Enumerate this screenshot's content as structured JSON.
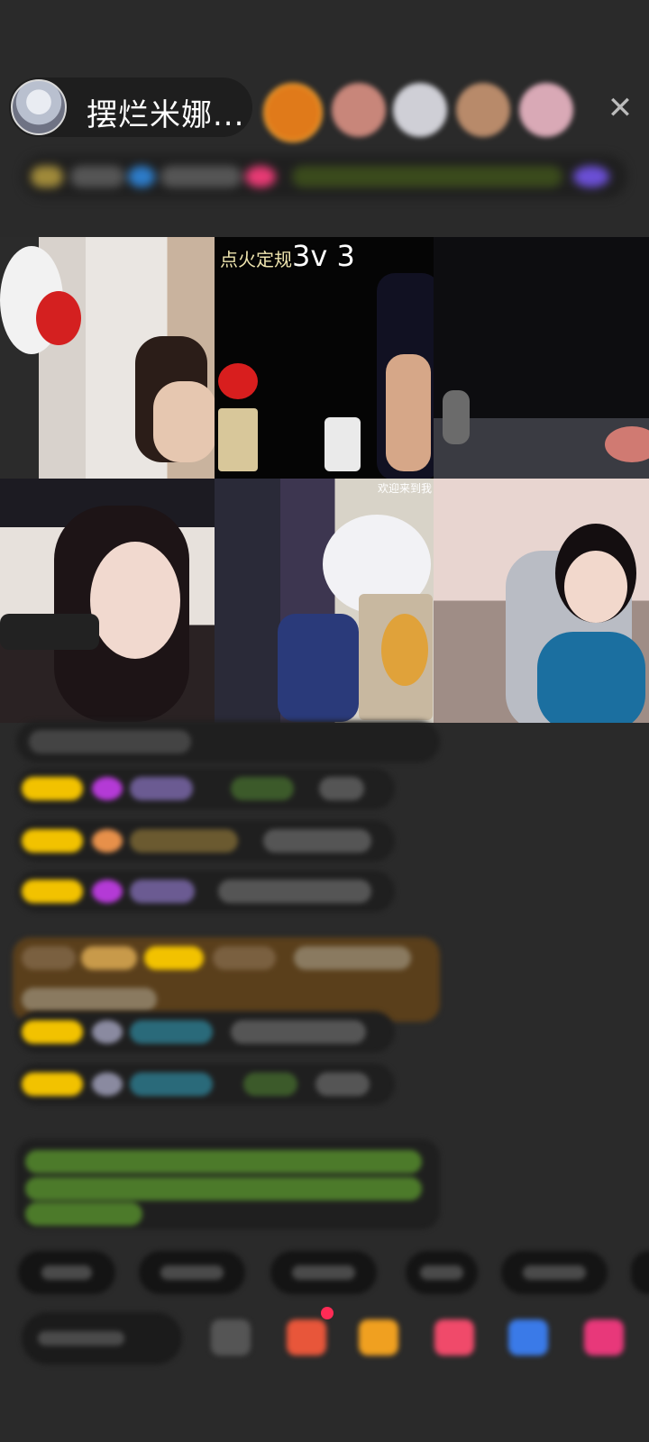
{
  "header": {
    "host_name": "摆烂米娜..."
  },
  "grid": {
    "tile2_label_text": "点火定规",
    "tile2_label_big": "3v 3",
    "tile5_label": "欢迎来到我"
  },
  "colors": {
    "background": "#2a2a2a",
    "level_badge": "#f2c200",
    "highlight_message_bg": "#5a3f1b",
    "green_text": "#7bd24f"
  }
}
